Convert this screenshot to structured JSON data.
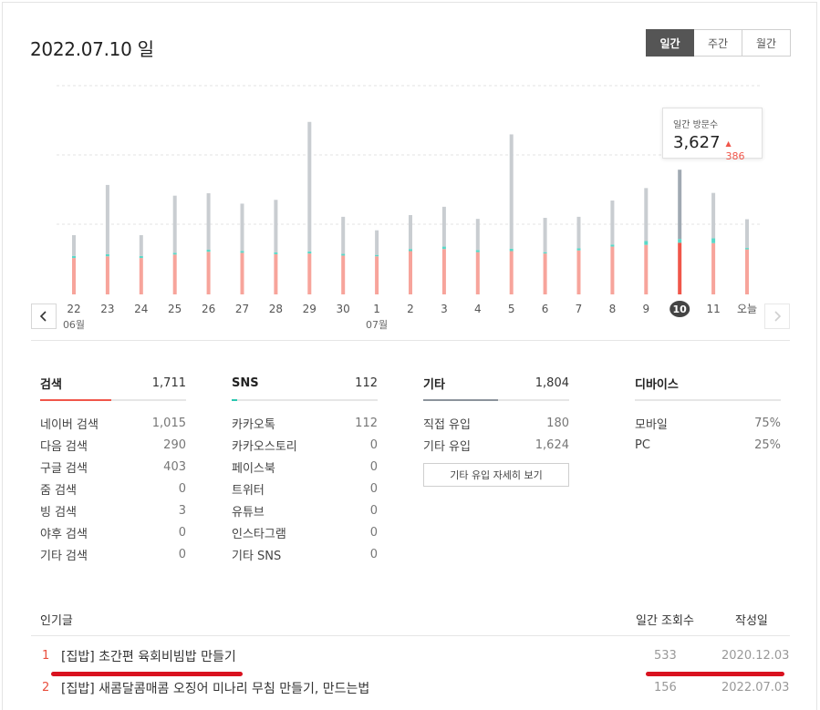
{
  "header": {
    "date_title": "2022.07.10 일",
    "period_tabs": [
      {
        "label": "일간",
        "active": true
      },
      {
        "label": "주간",
        "active": false
      },
      {
        "label": "월간",
        "active": false
      }
    ]
  },
  "chart_data": {
    "type": "bar",
    "categories": [
      "22",
      "23",
      "24",
      "25",
      "26",
      "27",
      "28",
      "29",
      "30",
      "1",
      "2",
      "3",
      "4",
      "5",
      "6",
      "7",
      "8",
      "9",
      "10",
      "11",
      "오늘"
    ],
    "month_labels": [
      {
        "category": "22",
        "label": "06월"
      },
      {
        "category": "1",
        "label": "07월"
      }
    ],
    "series": [
      {
        "values": [
          1050,
          1100,
          1050,
          1150,
          1230,
          1200,
          1160,
          1180,
          1120,
          1100,
          1250,
          1310,
          1220,
          1250,
          1180,
          1270,
          1380,
          1430,
          1490,
          1480,
          1300
        ]
      },
      {
        "values": [
          60,
          60,
          60,
          50,
          60,
          50,
          50,
          60,
          50,
          40,
          60,
          70,
          60,
          70,
          40,
          60,
          60,
          110,
          110,
          140,
          40
        ]
      },
      {
        "values": [
          600,
          2000,
          600,
          1650,
          1630,
          1370,
          1520,
          3740,
          1070,
          710,
          980,
          1150,
          900,
          3300,
          990,
          910,
          1270,
          1530,
          2000,
          1310,
          830
        ]
      }
    ],
    "colors": {
      "search": "#f7a49b",
      "sns": "#5ad8c8",
      "other": "#c9cdd1",
      "selected_search": "#f0564a",
      "selected_other": "#a0a9b2"
    },
    "selected_category": "10",
    "ylim": [
      0,
      6000
    ],
    "grid": true
  },
  "tooltip": {
    "label": "일간 방문수",
    "value": "3,627",
    "delta": "386",
    "delta_arrow": "▲"
  },
  "groups": [
    {
      "title": "검색",
      "total": "1,711",
      "bar_fraction": 0.49,
      "bar_color": "#f0564a",
      "items": [
        {
          "label": "네이버 검색",
          "value": "1,015"
        },
        {
          "label": "다음 검색",
          "value": "290"
        },
        {
          "label": "구글 검색",
          "value": "403"
        },
        {
          "label": "줌 검색",
          "value": "0"
        },
        {
          "label": "빙 검색",
          "value": "3"
        },
        {
          "label": "야후 검색",
          "value": "0"
        },
        {
          "label": "기타 검색",
          "value": "0"
        }
      ]
    },
    {
      "title": "SNS",
      "total": "112",
      "bar_fraction": 0.04,
      "bar_color": "#2cc7b0",
      "items": [
        {
          "label": "카카오톡",
          "value": "112"
        },
        {
          "label": "카카오스토리",
          "value": "0"
        },
        {
          "label": "페이스북",
          "value": "0"
        },
        {
          "label": "트위터",
          "value": "0"
        },
        {
          "label": "유튜브",
          "value": "0"
        },
        {
          "label": "인스타그램",
          "value": "0"
        },
        {
          "label": "기타 SNS",
          "value": "0"
        }
      ]
    },
    {
      "title": "기타",
      "total": "1,804",
      "bar_fraction": 0.51,
      "bar_color": "#8c949c",
      "items": [
        {
          "label": "직접 유입",
          "value": "180"
        },
        {
          "label": "기타 유입",
          "value": "1,624"
        }
      ],
      "more_button": "기타 유입 자세히 보기"
    },
    {
      "title": "디바이스",
      "total": "",
      "bar_fraction": 0,
      "bar_color": "#e6e6e6",
      "items": [
        {
          "label": "모바일",
          "value": "75%"
        },
        {
          "label": "PC",
          "value": "25%"
        }
      ]
    }
  ],
  "popular": {
    "title": "인기글",
    "col_views": "일간 조회수",
    "col_date": "작성일",
    "rows": [
      {
        "rank": "1",
        "title": "[집밥] 초간편 육회비빔밥 만들기",
        "views": "533",
        "date": "2020.12.03"
      },
      {
        "rank": "2",
        "title": "[집밥] 새콤달콤매콤 오징어 미나리 무침 만들기, 만드는법",
        "views": "156",
        "date": "2022.07.03"
      }
    ]
  }
}
